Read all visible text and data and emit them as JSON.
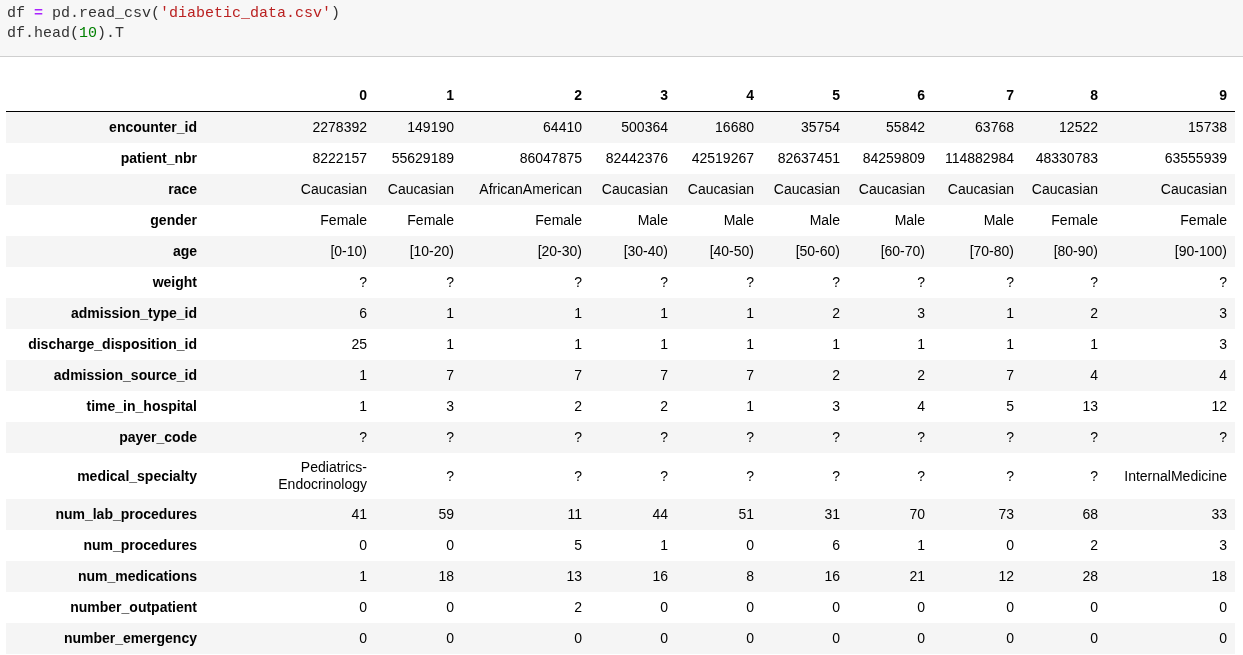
{
  "code_cell": {
    "lines": [
      [
        {
          "kind": "name",
          "text": "df "
        },
        {
          "kind": "operator",
          "text": "="
        },
        {
          "kind": "name",
          "text": " pd.read_csv("
        },
        {
          "kind": "string",
          "text": "'diabetic_data.csv'"
        },
        {
          "kind": "name",
          "text": ")"
        }
      ],
      [
        {
          "kind": "name",
          "text": "df.head("
        },
        {
          "kind": "number",
          "text": "10"
        },
        {
          "kind": "name",
          "text": ").T"
        }
      ]
    ]
  },
  "table": {
    "columns": [
      "0",
      "1",
      "2",
      "3",
      "4",
      "5",
      "6",
      "7",
      "8",
      "9"
    ],
    "rows": [
      {
        "label": "encounter_id",
        "cells": [
          "2278392",
          "149190",
          "64410",
          "500364",
          "16680",
          "35754",
          "55842",
          "63768",
          "12522",
          "15738"
        ]
      },
      {
        "label": "patient_nbr",
        "cells": [
          "8222157",
          "55629189",
          "86047875",
          "82442376",
          "42519267",
          "82637451",
          "84259809",
          "114882984",
          "48330783",
          "63555939"
        ]
      },
      {
        "label": "race",
        "cells": [
          "Caucasian",
          "Caucasian",
          "AfricanAmerican",
          "Caucasian",
          "Caucasian",
          "Caucasian",
          "Caucasian",
          "Caucasian",
          "Caucasian",
          "Caucasian"
        ]
      },
      {
        "label": "gender",
        "cells": [
          "Female",
          "Female",
          "Female",
          "Male",
          "Male",
          "Male",
          "Male",
          "Male",
          "Female",
          "Female"
        ]
      },
      {
        "label": "age",
        "cells": [
          "[0-10)",
          "[10-20)",
          "[20-30)",
          "[30-40)",
          "[40-50)",
          "[50-60)",
          "[60-70)",
          "[70-80)",
          "[80-90)",
          "[90-100)"
        ]
      },
      {
        "label": "weight",
        "cells": [
          "?",
          "?",
          "?",
          "?",
          "?",
          "?",
          "?",
          "?",
          "?",
          "?"
        ]
      },
      {
        "label": "admission_type_id",
        "cells": [
          "6",
          "1",
          "1",
          "1",
          "1",
          "2",
          "3",
          "1",
          "2",
          "3"
        ]
      },
      {
        "label": "discharge_disposition_id",
        "cells": [
          "25",
          "1",
          "1",
          "1",
          "1",
          "1",
          "1",
          "1",
          "1",
          "3"
        ]
      },
      {
        "label": "admission_source_id",
        "cells": [
          "1",
          "7",
          "7",
          "7",
          "7",
          "2",
          "2",
          "7",
          "4",
          "4"
        ]
      },
      {
        "label": "time_in_hospital",
        "cells": [
          "1",
          "3",
          "2",
          "2",
          "1",
          "3",
          "4",
          "5",
          "13",
          "12"
        ]
      },
      {
        "label": "payer_code",
        "cells": [
          "?",
          "?",
          "?",
          "?",
          "?",
          "?",
          "?",
          "?",
          "?",
          "?"
        ]
      },
      {
        "label": "medical_specialty",
        "cells": [
          "Pediatrics-Endocrinology",
          "?",
          "?",
          "?",
          "?",
          "?",
          "?",
          "?",
          "?",
          "InternalMedicine"
        ]
      },
      {
        "label": "num_lab_procedures",
        "cells": [
          "41",
          "59",
          "11",
          "44",
          "51",
          "31",
          "70",
          "73",
          "68",
          "33"
        ]
      },
      {
        "label": "num_procedures",
        "cells": [
          "0",
          "0",
          "5",
          "1",
          "0",
          "6",
          "1",
          "0",
          "2",
          "3"
        ]
      },
      {
        "label": "num_medications",
        "cells": [
          "1",
          "18",
          "13",
          "16",
          "8",
          "16",
          "21",
          "12",
          "28",
          "18"
        ]
      },
      {
        "label": "number_outpatient",
        "cells": [
          "0",
          "0",
          "2",
          "0",
          "0",
          "0",
          "0",
          "0",
          "0",
          "0"
        ]
      },
      {
        "label": "number_emergency",
        "cells": [
          "0",
          "0",
          "0",
          "0",
          "0",
          "0",
          "0",
          "0",
          "0",
          "0"
        ]
      }
    ]
  }
}
